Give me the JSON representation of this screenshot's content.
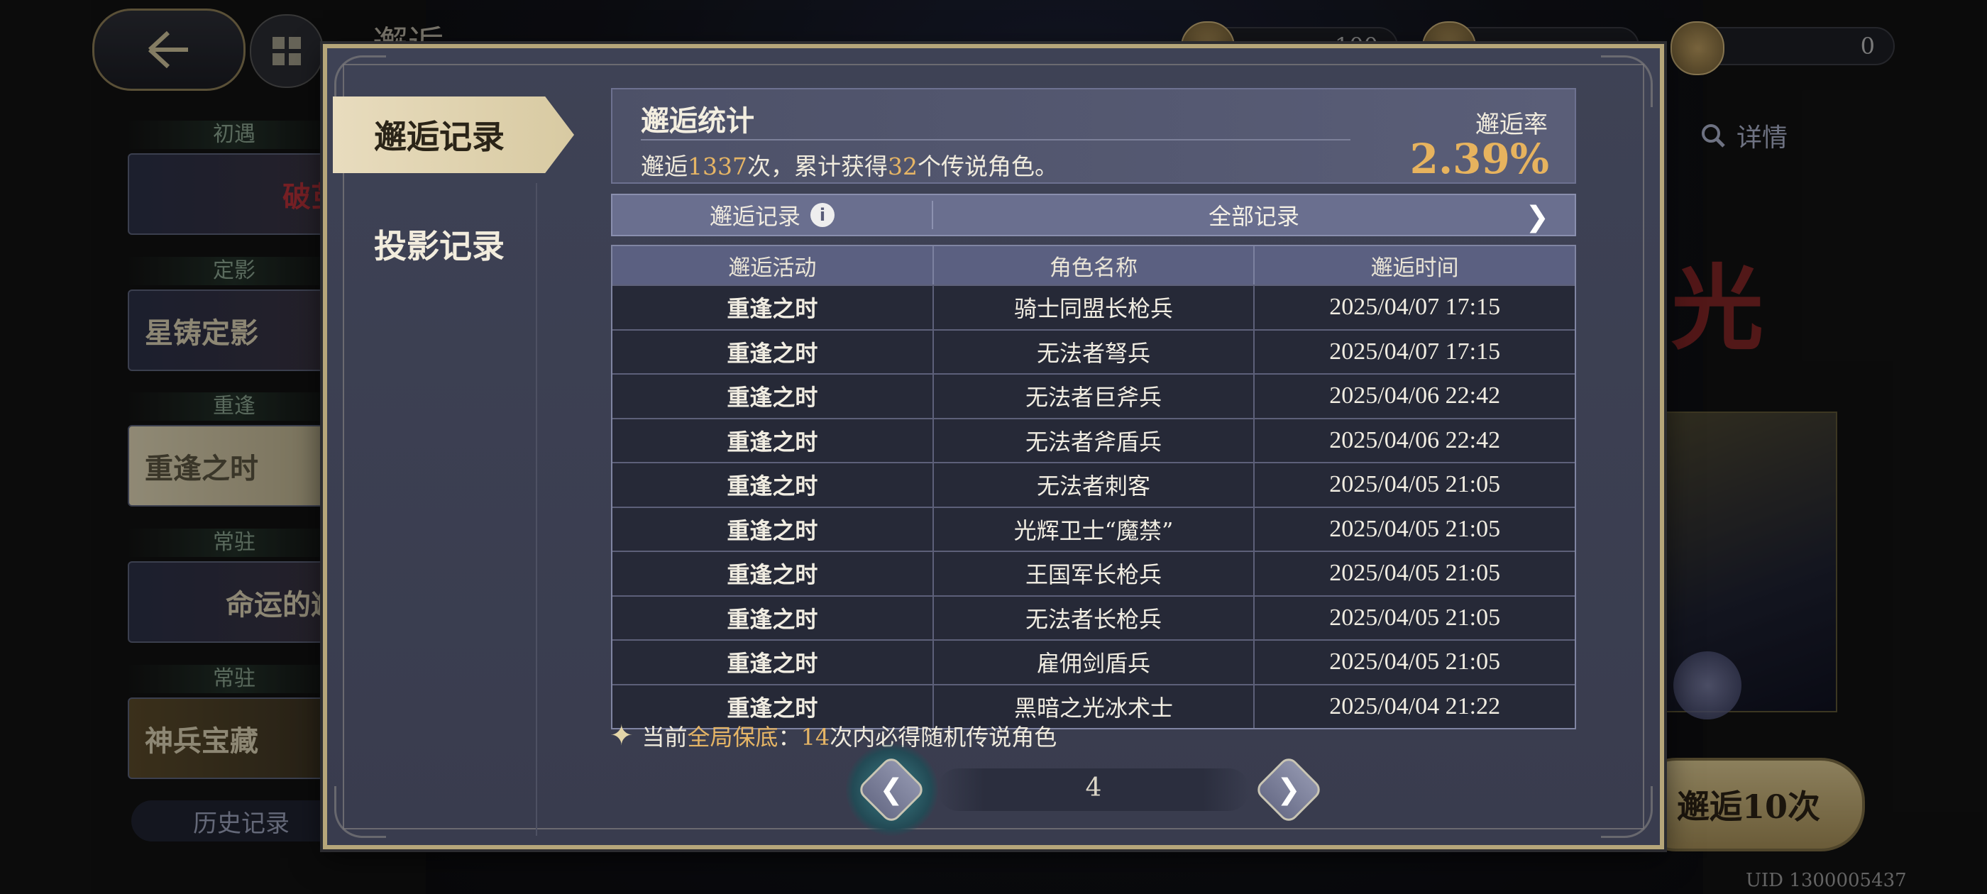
{
  "background": {
    "page_title": "邂逅",
    "currencies": [
      "100",
      "",
      "0"
    ],
    "sidebar": [
      {
        "label": "初遇",
        "card": "破茧"
      },
      {
        "label": "定影",
        "card": "星铸定影"
      },
      {
        "label": "重逢",
        "card": "重逢之时"
      },
      {
        "label": "常驻",
        "card": "命运的邂"
      },
      {
        "label": "常驻",
        "card": "神兵宝藏"
      }
    ],
    "history_button": "历史记录",
    "detail_button": "详情",
    "banner_char": "光",
    "pull_ten_button": "邂逅10次",
    "uid": "UID 1300005437"
  },
  "modal": {
    "tabs": {
      "encounter_records": "邂逅记录",
      "projection_records": "投影记录"
    },
    "stats": {
      "title": "邂逅统计",
      "text_prefix": "邂逅",
      "pull_count": "1337",
      "text_middle": "次，累计获得",
      "legendary_count": "32",
      "text_suffix": "个传说角色。",
      "rate_label": "邂逅率",
      "rate_value": "2.39%"
    },
    "filter": {
      "left_label": "邂逅记录",
      "right_label": "全部记录"
    },
    "table": {
      "headers": [
        "邂逅活动",
        "角色名称",
        "邂逅时间"
      ],
      "rows": [
        [
          "重逢之时",
          "骑士同盟长枪兵",
          "2025/04/07 17:15"
        ],
        [
          "重逢之时",
          "无法者弩兵",
          "2025/04/07 17:15"
        ],
        [
          "重逢之时",
          "无法者巨斧兵",
          "2025/04/06 22:42"
        ],
        [
          "重逢之时",
          "无法者斧盾兵",
          "2025/04/06 22:42"
        ],
        [
          "重逢之时",
          "无法者刺客",
          "2025/04/05 21:05"
        ],
        [
          "重逢之时",
          "光辉卫士“魔禁”",
          "2025/04/05 21:05"
        ],
        [
          "重逢之时",
          "王国军长枪兵",
          "2025/04/05 21:05"
        ],
        [
          "重逢之时",
          "无法者长枪兵",
          "2025/04/05 21:05"
        ],
        [
          "重逢之时",
          "雇佣剑盾兵",
          "2025/04/05 21:05"
        ],
        [
          "重逢之时",
          "黑暗之光冰术士",
          "2025/04/04 21:22"
        ]
      ]
    },
    "pity": {
      "prefix": "当前",
      "highlight": "全局保底",
      "colon": "：",
      "count": "14",
      "suffix": "次内必得随机传说角色"
    },
    "pagination": {
      "page": "4"
    }
  },
  "colors": {
    "accent_gold": "#e7b35e",
    "modal_bg": "#3e4255",
    "frame_gold": "#b6a67a"
  }
}
